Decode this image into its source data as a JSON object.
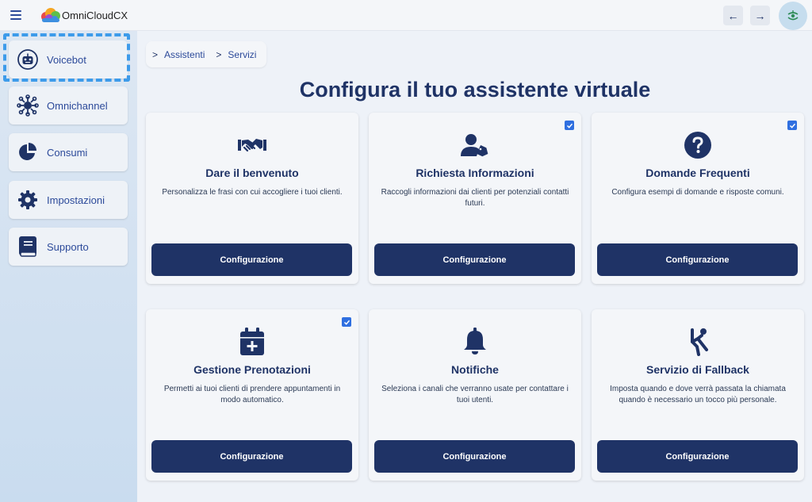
{
  "app": {
    "brand": "OmniCloudCX",
    "back_icon": "←",
    "forward_icon": "→"
  },
  "sidebar": {
    "items": [
      {
        "label": "Voicebot",
        "icon": "robot-icon",
        "focused": true
      },
      {
        "label": "Omnichannel",
        "icon": "network-icon"
      },
      {
        "label": "Consumi",
        "icon": "pie-chart-icon"
      },
      {
        "label": "Impostazioni",
        "icon": "gear-icon"
      },
      {
        "label": "Supporto",
        "icon": "book-icon"
      }
    ]
  },
  "breadcrumb": {
    "chevron": ">",
    "items": [
      "Assistenti",
      "Servizi"
    ]
  },
  "main": {
    "title": "Configura il tuo assistente virtuale"
  },
  "cards": [
    {
      "title": "Dare il benvenuto",
      "description": "Personalizza le frasi con cui accogliere i tuoi clienti.",
      "button": "Configurazione",
      "checked": false,
      "icon": "handshake-icon"
    },
    {
      "title": "Richiesta Informazioni",
      "description": "Raccogli informazioni dai clienti per potenziali contatti futuri.",
      "button": "Configurazione",
      "checked": true,
      "icon": "user-tag-icon"
    },
    {
      "title": "Domande Frequenti",
      "description": "Configura esempi di domande e risposte comuni.",
      "button": "Configurazione",
      "checked": true,
      "icon": "question-circle-icon"
    },
    {
      "title": "Gestione Prenotazioni",
      "description": "Permetti ai tuoi clienti di prendere appuntamenti in modo automatico.",
      "button": "Configurazione",
      "checked": true,
      "icon": "calendar-plus-icon"
    },
    {
      "title": "Notifiche",
      "description": "Seleziona i canali che verranno usate per contattare i tuoi utenti.",
      "button": "Configurazione",
      "checked": false,
      "icon": "bell-icon"
    },
    {
      "title": "Servizio di Fallback",
      "description": "Imposta quando e dove verrà passata la chiamata quando è necessario un tocco più personale.",
      "button": "Configurazione",
      "checked": false,
      "icon": "person-falling-icon"
    }
  ],
  "colors": {
    "primary": "#1f3366",
    "accent": "#2f6fe0",
    "focus": "#3d9bea"
  }
}
